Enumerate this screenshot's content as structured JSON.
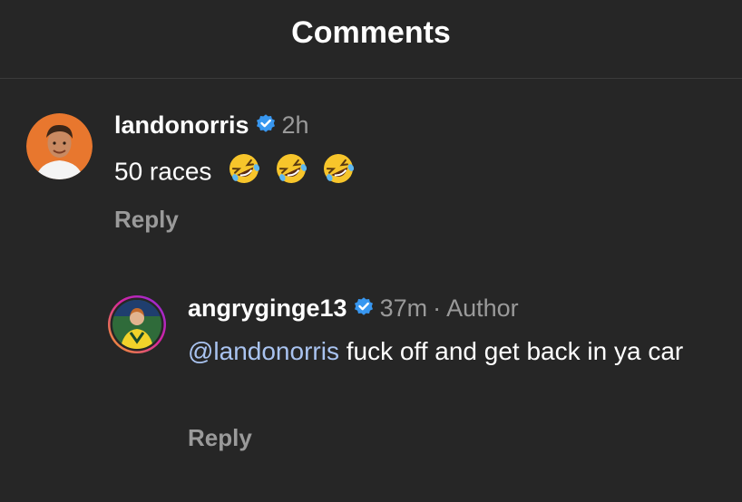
{
  "header": {
    "title": "Comments"
  },
  "comments": [
    {
      "username": "landonorris",
      "time": "2h",
      "text_pre": "50  races",
      "emojis": [
        "rolling-on-floor-laughing",
        "rolling-on-floor-laughing",
        "rolling-on-floor-laughing"
      ],
      "reply_label": "Reply",
      "avatar_color": "#e8772e"
    },
    {
      "username": "angryginge13",
      "time": "37m",
      "author_tag": "· Author",
      "mention": "@landonorris",
      "text": " fuck off and get back in ya car",
      "reply_label": "Reply",
      "story_ring_colors": [
        "#f5a623",
        "#d6249f",
        "#8a2be2"
      ]
    }
  ],
  "colors": {
    "background": "#262626",
    "verified_badge": "#3897f0",
    "mention": "#a9c3f0",
    "secondary_text": "#9a9a9a"
  }
}
